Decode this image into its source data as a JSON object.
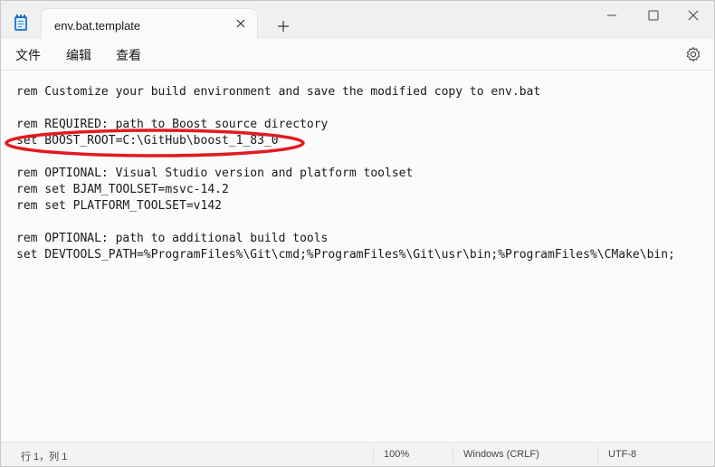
{
  "tab": {
    "title": "env.bat.template"
  },
  "menu": {
    "file": "文件",
    "edit": "编辑",
    "view": "查看"
  },
  "editor": {
    "lines": [
      "rem Customize your build environment and save the modified copy to env.bat",
      "",
      "rem REQUIRED: path to Boost source directory",
      "set BOOST_ROOT=C:\\GitHub\\boost_1_83_0",
      "",
      "rem OPTIONAL: Visual Studio version and platform toolset",
      "rem set BJAM_TOOLSET=msvc-14.2",
      "rem set PLATFORM_TOOLSET=v142",
      "",
      "rem OPTIONAL: path to additional build tools",
      "set DEVTOOLS_PATH=%ProgramFiles%\\Git\\cmd;%ProgramFiles%\\Git\\usr\\bin;%ProgramFiles%\\CMake\\bin;"
    ]
  },
  "status": {
    "position": "行 1，列 1",
    "zoom": "100%",
    "line_ending": "Windows (CRLF)",
    "encoding": "UTF-8"
  },
  "colors": {
    "annotation": "#e11b22",
    "background": "#f3f3f3",
    "editor": "#fbfbfb"
  },
  "icons": [
    "notepad-icon",
    "close-icon",
    "plus-icon",
    "minimize-icon",
    "maximize-icon",
    "window-close-icon",
    "gear-icon"
  ]
}
